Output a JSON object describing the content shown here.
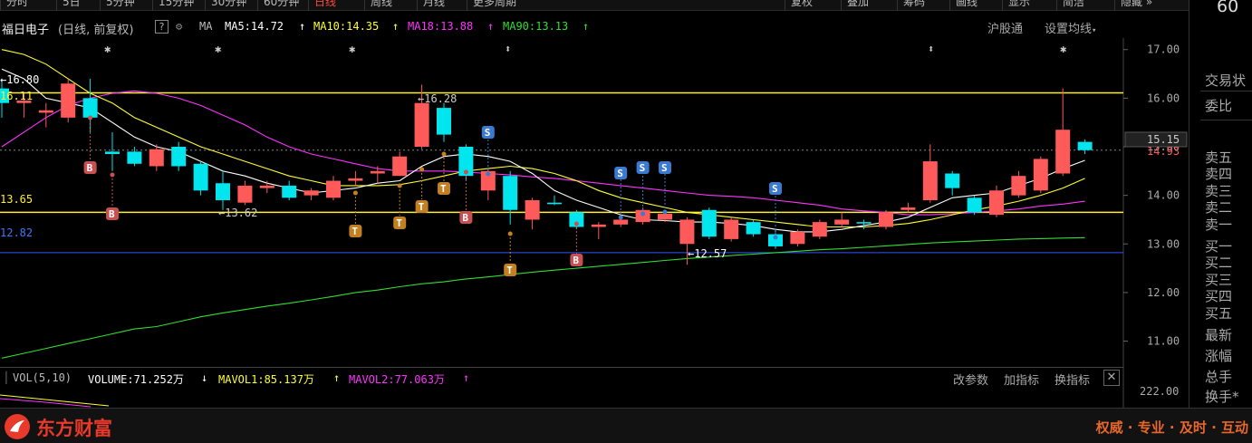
{
  "topbar": {
    "tabs": [
      "分时",
      "5日",
      "5分钟",
      "15分钟",
      "30分钟",
      "60分钟",
      "日线",
      "周线",
      "月线",
      "更多周期",
      "复权",
      "叠加",
      "筹码",
      "画线",
      "显示",
      "简洁",
      "隐藏 »"
    ],
    "active_tab": "日线"
  },
  "header": {
    "title": "福日电子",
    "subtitle": "(日线, 前复权)",
    "ma_label": "MA",
    "ma5": "MA5:14.72",
    "ma10": "MA10:14.35",
    "ma18": "MA18:13.88",
    "ma90": "MA90:13.13",
    "hgt": "沪股通",
    "settings": "设置均线"
  },
  "colors": {
    "up": "#ff5a5a",
    "down": "#00e5ee",
    "ma5": "#ffffff",
    "ma10": "#ffff33",
    "ma18": "#ff33ff",
    "ma90": "#33dd33",
    "hline": "#ffee33",
    "blueline": "#3355ff"
  },
  "price_axis": {
    "ticks": [
      "17.00",
      "16.00",
      "15.00",
      "14.00",
      "13.00",
      "12.00",
      "11.00"
    ],
    "current_price": "14.93",
    "cursor_price": "15.15",
    "vol_tick": "222.00"
  },
  "annotations": {
    "high1": "16.80",
    "left_1611": "16.11",
    "left_1365": "13.65",
    "left_1282": "12.82",
    "low_1362": "13.62",
    "high_1628": "16.28",
    "low_1257": "12.57"
  },
  "markers": {
    "B": "B",
    "S": "S",
    "T": "T"
  },
  "volume": {
    "label": "VOL(5,10)",
    "volume": "VOLUME:71.252万",
    "mavol1": "MAVOL1:85.137万",
    "mavol2": "MAVOL2:77.063万",
    "btn1": "改参数",
    "btn2": "加指标",
    "btn3": "换指标"
  },
  "right_panel": {
    "top_value": "60",
    "items": [
      "交易状",
      "委比",
      "卖五",
      "卖四",
      "卖三",
      "卖二",
      "卖一",
      "买一",
      "买二",
      "买三",
      "买四",
      "买五",
      "最新",
      "涨幅",
      "总手",
      "换手*"
    ]
  },
  "footer": {
    "brand": "东方财富",
    "slogan": "权威 · 专业 · 及时 · 互动"
  },
  "chart_data": {
    "type": "candlestick",
    "ylim": [
      10.6,
      17.2
    ],
    "candles": [
      {
        "o": 16.2,
        "c": 15.9,
        "h": 16.4,
        "l": 15.6
      },
      {
        "o": 15.9,
        "c": 15.95,
        "h": 16.1,
        "l": 15.6
      },
      {
        "o": 15.7,
        "c": 15.75,
        "h": 15.9,
        "l": 15.4
      },
      {
        "o": 15.6,
        "c": 16.3,
        "h": 16.4,
        "l": 15.5
      },
      {
        "o": 16.0,
        "c": 15.6,
        "h": 16.4,
        "l": 15.3
      },
      {
        "o": 14.9,
        "c": 14.85,
        "h": 15.3,
        "l": 14.5
      },
      {
        "o": 14.9,
        "c": 14.65,
        "h": 15.0,
        "l": 14.6
      },
      {
        "o": 14.6,
        "c": 14.95,
        "h": 15.05,
        "l": 14.5
      },
      {
        "o": 15.0,
        "c": 14.6,
        "h": 15.1,
        "l": 14.5
      },
      {
        "o": 14.65,
        "c": 14.1,
        "h": 14.7,
        "l": 14.0
      },
      {
        "o": 14.25,
        "c": 13.9,
        "h": 14.5,
        "l": 13.7
      },
      {
        "o": 13.85,
        "c": 14.2,
        "h": 14.3,
        "l": 13.8
      },
      {
        "o": 14.15,
        "c": 14.2,
        "h": 14.3,
        "l": 14.05
      },
      {
        "o": 14.2,
        "c": 13.95,
        "h": 14.3,
        "l": 13.9
      },
      {
        "o": 14.0,
        "c": 14.1,
        "h": 14.15,
        "l": 13.9
      },
      {
        "o": 13.95,
        "c": 14.3,
        "h": 14.4,
        "l": 13.9
      },
      {
        "o": 14.3,
        "c": 14.35,
        "h": 14.5,
        "l": 14.2
      },
      {
        "o": 14.45,
        "c": 14.5,
        "h": 14.6,
        "l": 14.25
      },
      {
        "o": 14.4,
        "c": 14.8,
        "h": 14.9,
        "l": 14.4
      },
      {
        "o": 15.0,
        "c": 15.9,
        "h": 16.28,
        "l": 14.95
      },
      {
        "o": 15.8,
        "c": 15.25,
        "h": 15.9,
        "l": 15.1
      },
      {
        "o": 15.0,
        "c": 14.4,
        "h": 15.05,
        "l": 14.3
      },
      {
        "o": 14.1,
        "c": 14.5,
        "h": 14.55,
        "l": 13.9
      },
      {
        "o": 14.4,
        "c": 13.7,
        "h": 14.5,
        "l": 13.4
      },
      {
        "o": 13.5,
        "c": 13.9,
        "h": 13.95,
        "l": 13.3
      },
      {
        "o": 13.85,
        "c": 13.82,
        "h": 14.0,
        "l": 13.8
      },
      {
        "o": 13.65,
        "c": 13.35,
        "h": 13.7,
        "l": 13.3
      },
      {
        "o": 13.35,
        "c": 13.4,
        "h": 13.45,
        "l": 13.1
      },
      {
        "o": 13.4,
        "c": 13.5,
        "h": 13.6,
        "l": 13.35
      },
      {
        "o": 13.45,
        "c": 13.7,
        "h": 13.75,
        "l": 13.4
      },
      {
        "o": 13.5,
        "c": 13.62,
        "h": 13.7,
        "l": 13.45
      },
      {
        "o": 13.0,
        "c": 13.5,
        "h": 13.55,
        "l": 12.57
      },
      {
        "o": 13.7,
        "c": 13.15,
        "h": 13.75,
        "l": 13.1
      },
      {
        "o": 13.1,
        "c": 13.5,
        "h": 13.55,
        "l": 13.05
      },
      {
        "o": 13.45,
        "c": 13.2,
        "h": 13.5,
        "l": 13.15
      },
      {
        "o": 13.2,
        "c": 12.95,
        "h": 13.3,
        "l": 12.9
      },
      {
        "o": 13.0,
        "c": 13.25,
        "h": 13.3,
        "l": 12.95
      },
      {
        "o": 13.15,
        "c": 13.45,
        "h": 13.5,
        "l": 13.1
      },
      {
        "o": 13.4,
        "c": 13.5,
        "h": 13.65,
        "l": 13.35
      },
      {
        "o": 13.45,
        "c": 13.42,
        "h": 13.5,
        "l": 13.3
      },
      {
        "o": 13.35,
        "c": 13.65,
        "h": 13.7,
        "l": 13.3
      },
      {
        "o": 13.7,
        "c": 13.75,
        "h": 13.85,
        "l": 13.65
      },
      {
        "o": 13.9,
        "c": 14.7,
        "h": 15.05,
        "l": 13.85
      },
      {
        "o": 14.45,
        "c": 14.15,
        "h": 14.5,
        "l": 14.0
      },
      {
        "o": 13.95,
        "c": 13.65,
        "h": 14.0,
        "l": 13.6
      },
      {
        "o": 13.6,
        "c": 14.1,
        "h": 14.2,
        "l": 13.55
      },
      {
        "o": 14.0,
        "c": 14.4,
        "h": 14.5,
        "l": 13.95
      },
      {
        "o": 14.1,
        "c": 14.75,
        "h": 14.8,
        "l": 14.05
      },
      {
        "o": 14.45,
        "c": 15.35,
        "h": 16.2,
        "l": 14.4
      },
      {
        "o": 15.1,
        "c": 14.93,
        "h": 15.15,
        "l": 14.85
      }
    ],
    "ma5": [
      16.6,
      16.4,
      16.0,
      15.9,
      15.8,
      15.5,
      15.2,
      15.0,
      14.9,
      14.7,
      14.5,
      14.4,
      14.25,
      14.15,
      14.05,
      14.1,
      14.15,
      14.25,
      14.3,
      14.6,
      14.8,
      14.85,
      14.8,
      14.7,
      14.45,
      14.1,
      13.9,
      13.75,
      13.6,
      13.5,
      13.48,
      13.45,
      13.45,
      13.42,
      13.38,
      13.3,
      13.25,
      13.25,
      13.3,
      13.38,
      13.45,
      13.55,
      13.75,
      13.95,
      14.0,
      14.05,
      14.2,
      14.35,
      14.55,
      14.72
    ],
    "ma10": [
      17.0,
      16.9,
      16.7,
      16.4,
      16.1,
      15.9,
      15.6,
      15.4,
      15.2,
      15.0,
      14.85,
      14.7,
      14.55,
      14.4,
      14.3,
      14.2,
      14.2,
      14.2,
      14.22,
      14.3,
      14.4,
      14.5,
      14.55,
      14.6,
      14.55,
      14.45,
      14.3,
      14.1,
      13.95,
      13.85,
      13.75,
      13.65,
      13.6,
      13.55,
      13.5,
      13.45,
      13.4,
      13.35,
      13.35,
      13.35,
      13.38,
      13.42,
      13.5,
      13.6,
      13.7,
      13.78,
      13.88,
      14.0,
      14.15,
      14.35
    ],
    "ma18": [
      15.0,
      15.3,
      15.6,
      15.85,
      16.0,
      16.1,
      16.15,
      16.1,
      16.0,
      15.85,
      15.65,
      15.45,
      15.2,
      15.0,
      14.85,
      14.75,
      14.65,
      14.55,
      14.5,
      14.5,
      14.5,
      14.48,
      14.45,
      14.42,
      14.38,
      14.35,
      14.3,
      14.25,
      14.2,
      14.15,
      14.1,
      14.05,
      14.0,
      13.98,
      13.95,
      13.9,
      13.85,
      13.8,
      13.72,
      13.68,
      13.65,
      13.6,
      13.6,
      13.62,
      13.65,
      13.68,
      13.72,
      13.78,
      13.82,
      13.88
    ],
    "ma90": [
      10.65,
      10.75,
      10.85,
      10.95,
      11.05,
      11.15,
      11.25,
      11.3,
      11.4,
      11.5,
      11.58,
      11.65,
      11.72,
      11.78,
      11.85,
      11.92,
      12.0,
      12.05,
      12.12,
      12.18,
      12.22,
      12.28,
      12.32,
      12.37,
      12.42,
      12.46,
      12.5,
      12.54,
      12.58,
      12.62,
      12.66,
      12.7,
      12.73,
      12.76,
      12.79,
      12.82,
      12.85,
      12.88,
      12.9,
      12.93,
      12.96,
      12.99,
      13.02,
      13.04,
      13.06,
      13.08,
      13.1,
      13.11,
      13.12,
      13.13
    ],
    "hlines": [
      16.11,
      13.65,
      12.82,
      14.93
    ]
  }
}
